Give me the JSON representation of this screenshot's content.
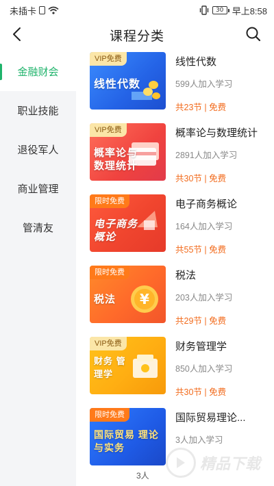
{
  "status_bar": {
    "carrier": "未插卡",
    "battery": "30",
    "time": "早上8:58"
  },
  "header": {
    "title": "课程分类",
    "back_icon": "chevron-left-icon",
    "search_icon": "search-icon"
  },
  "sidebar": {
    "items": [
      {
        "label": "金融财会",
        "active": true
      },
      {
        "label": "职业技能",
        "active": false
      },
      {
        "label": "退役军人",
        "active": false
      },
      {
        "label": "商业管理",
        "active": false
      },
      {
        "label": "管清友",
        "active": false
      }
    ]
  },
  "colors": {
    "accent": "#1fb36b",
    "price": "#f26a1b",
    "sidebar_bg": "#f4f5f7"
  },
  "courses": [
    {
      "tag": "VIP免费",
      "cover_text": "线性代数",
      "title": "线性代数",
      "students": "599人加入学习",
      "meta": "共23节 | 免费"
    },
    {
      "tag": "VIP免费",
      "cover_text": "概率论与 数理统计",
      "title": "概率论与数理统计",
      "students": "2891人加入学习",
      "meta": "共30节 | 免费"
    },
    {
      "tag": "限时免费",
      "cover_text": "电子商务 概论",
      "title": "电子商务概论",
      "students": "164人加入学习",
      "meta": "共55节 | 免费"
    },
    {
      "tag": "限时免费",
      "cover_text": "税法",
      "title": "税法",
      "students": "203人加入学习",
      "meta": "共29节 | 免费"
    },
    {
      "tag": "VIP免费",
      "cover_text": "财务 管理学",
      "title": "财务管理学",
      "students": "850人加入学习",
      "meta": "共30节 | 免费"
    },
    {
      "tag": "限时免费",
      "cover_text": "国际贸易 理论与实务",
      "title": "国际贸易理论...",
      "students": "3人加入学习",
      "meta": ""
    }
  ],
  "bottom": {
    "count_text": "3人",
    "watermark": "精品下载"
  }
}
